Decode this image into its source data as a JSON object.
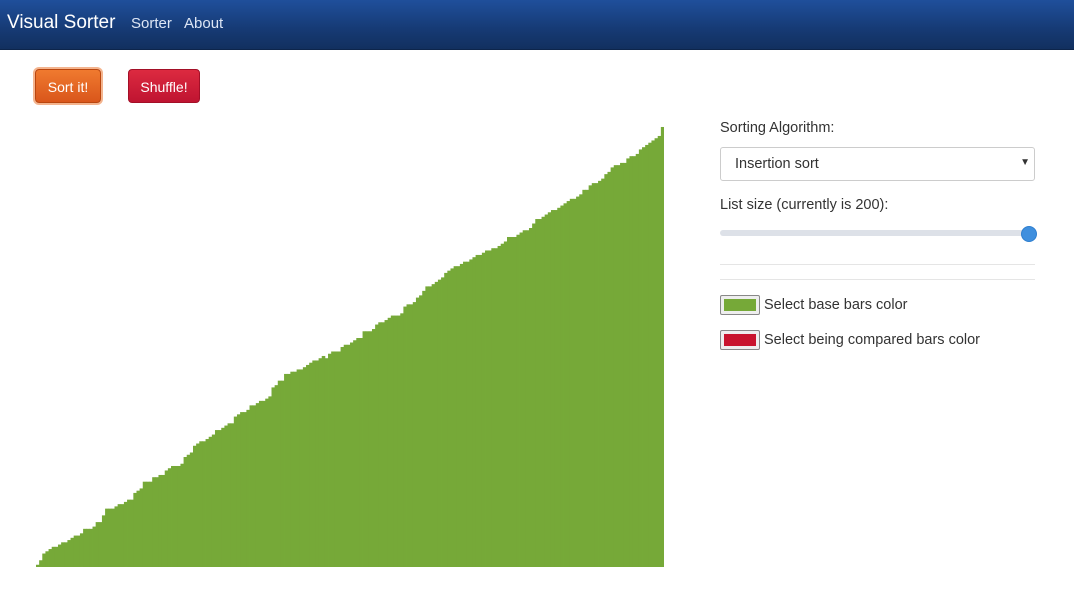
{
  "navbar": {
    "brand": "Visual Sorter",
    "links": [
      "Sorter",
      "About"
    ]
  },
  "buttons": {
    "sort_label": "Sort it!",
    "shuffle_label": "Shuffle!"
  },
  "controls": {
    "algorithm_label": "Sorting Algorithm:",
    "algorithm_selected": "Insertion sort",
    "list_size_label": "List size (currently is 200):",
    "list_size_value": 200,
    "list_size_max": 200,
    "base_color_label": "Select base bars color",
    "compare_color_label": "Select being compared bars color"
  },
  "colors": {
    "base_bars": "#76a938",
    "compared_bars": "#c8142e",
    "sort_button": "#e4631f",
    "shuffle_button": "#cc1d37",
    "navbar": "#163a74",
    "slider_thumb": "#3f8fde"
  },
  "chart_data": {
    "type": "bar",
    "bar_count": 200,
    "ordering": "ascending (sorted)",
    "value_min": 0,
    "value_max": 200,
    "values": [
      1,
      3,
      6,
      7,
      8,
      9,
      9,
      10,
      11,
      11,
      12,
      13,
      14,
      14,
      15,
      17,
      17,
      17,
      18,
      20,
      20,
      23,
      26,
      26,
      26,
      27,
      28,
      28,
      29,
      30,
      30,
      33,
      34,
      35,
      38,
      38,
      38,
      40,
      40,
      41,
      41,
      43,
      44,
      45,
      45,
      45,
      46,
      49,
      50,
      51,
      54,
      55,
      56,
      56,
      57,
      58,
      59,
      61,
      61,
      62,
      63,
      64,
      64,
      67,
      68,
      69,
      69,
      70,
      72,
      72,
      73,
      74,
      74,
      75,
      76,
      80,
      81,
      83,
      83,
      86,
      86,
      87,
      87,
      88,
      88,
      89,
      90,
      91,
      92,
      92,
      93,
      94,
      93,
      95,
      96,
      96,
      96,
      98,
      99,
      99,
      100,
      101,
      102,
      102,
      105,
      105,
      105,
      106,
      108,
      109,
      109,
      110,
      111,
      112,
      112,
      112,
      113,
      116,
      117,
      117,
      118,
      120,
      121,
      123,
      125,
      125,
      126,
      127,
      128,
      129,
      131,
      132,
      133,
      134,
      134,
      135,
      136,
      136,
      137,
      138,
      139,
      139,
      140,
      141,
      141,
      142,
      142,
      143,
      144,
      145,
      147,
      147,
      147,
      148,
      149,
      150,
      150,
      151,
      153,
      155,
      155,
      156,
      157,
      158,
      159,
      159,
      160,
      161,
      162,
      163,
      164,
      164,
      165,
      166,
      168,
      168,
      170,
      171,
      171,
      172,
      173,
      175,
      176,
      178,
      179,
      179,
      180,
      180,
      182,
      183,
      183,
      184,
      186,
      187,
      188,
      189,
      190,
      191,
      192,
      196
    ]
  }
}
